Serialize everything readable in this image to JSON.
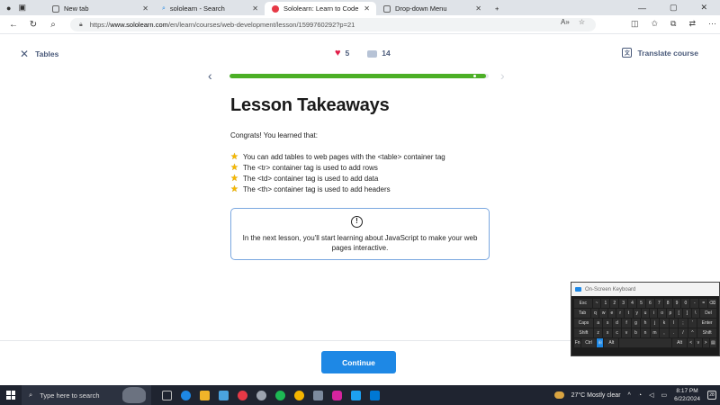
{
  "browser": {
    "tabs": [
      {
        "label": "New tab",
        "active": false
      },
      {
        "label": "sololearn - Search",
        "active": false
      },
      {
        "label": "Sololearn: Learn to Code",
        "active": true
      },
      {
        "label": "Drop-down Menu",
        "active": false
      }
    ],
    "url_prefix": "https://",
    "url_host": "www.sololearn.com",
    "url_path": "/en/learn/courses/web-development/lesson/1599760292?p=21"
  },
  "header": {
    "back_label": "Tables",
    "likes": "5",
    "comments": "14",
    "translate_label": "Translate course"
  },
  "progress": {
    "fraction": 0.99
  },
  "lesson": {
    "title": "Lesson Takeaways",
    "intro": "Congrats! You learned that:",
    "takeaways": [
      "You can add tables to web pages with the <table> container tag",
      "The <tr> container tag is used to add rows",
      "The <td> container tag is used to add data",
      "The <th> container tag is used to add headers"
    ],
    "next_message": "In the next lesson, you'll start learning about JavaScript to make your web pages interactive."
  },
  "continue_label": "Continue",
  "osk": {
    "title": "On-Screen Keyboard",
    "rows": [
      [
        "Esc",
        "~",
        "1",
        "2",
        "3",
        "4",
        "5",
        "6",
        "7",
        "8",
        "9",
        "0",
        "-",
        "=",
        "⌫"
      ],
      [
        "Tab",
        "q",
        "w",
        "e",
        "r",
        "t",
        "y",
        "u",
        "i",
        "o",
        "p",
        "[",
        "]",
        "\\",
        "Del"
      ],
      [
        "Caps",
        "a",
        "s",
        "d",
        "f",
        "g",
        "h",
        "j",
        "k",
        "l",
        ";",
        "'",
        "Enter"
      ],
      [
        "Shift",
        "z",
        "x",
        "c",
        "v",
        "b",
        "n",
        "m",
        ",",
        ".",
        "/",
        "^",
        "Shift"
      ],
      [
        "Fn",
        "Ctrl",
        "⊞",
        "Alt",
        "",
        "Alt",
        "<",
        "v",
        ">",
        "▤"
      ]
    ]
  },
  "taskbar": {
    "search_placeholder": "Type here to search",
    "weather": "27°C  Mostly clear",
    "time": "8:17 PM",
    "date": "6/22/2024",
    "notifications": "28"
  }
}
